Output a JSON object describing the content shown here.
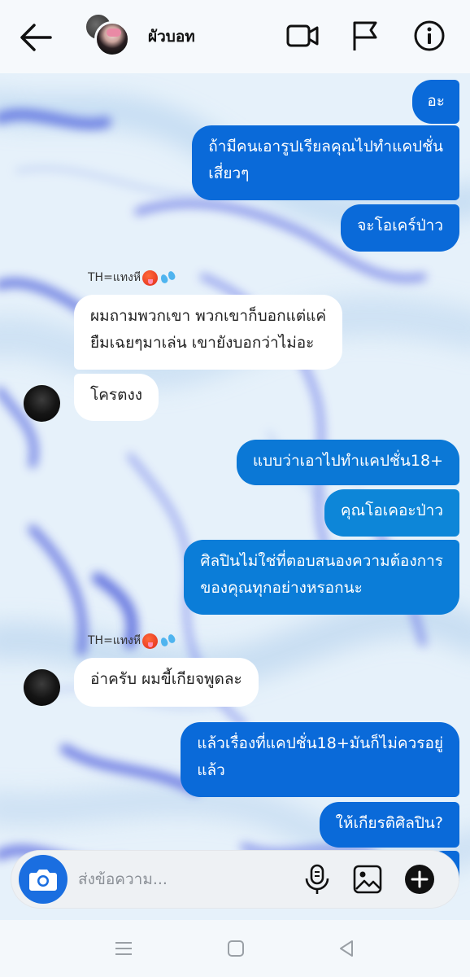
{
  "header": {
    "contact_name": "ผัวบอท",
    "icons": [
      "back-arrow-icon",
      "video-call-icon",
      "flag-icon",
      "info-icon"
    ]
  },
  "messages": [
    {
      "side": "out",
      "text": [
        "อะ"
      ]
    },
    {
      "side": "out",
      "text": [
        "ถ้ามีคนเอารูปเรียลคุณไปทำแคปชั่น",
        "เสี่ยวๆ"
      ]
    },
    {
      "side": "out",
      "text": [
        "จะโอเคร์ป่าว"
      ]
    },
    {
      "side": "in",
      "sender": "TH=แทงหี",
      "text": [
        "ผมถามพวกเขา พวกเขาก็บอกแต่แค่",
        "ยืมเฉยๆมาเล่น เขายังบอกว่าไม่อะ"
      ]
    },
    {
      "side": "in",
      "text": [
        "โครตงง"
      ]
    },
    {
      "side": "out",
      "text": [
        "แบบว่าเอาไปทำแคปชั่น18+"
      ]
    },
    {
      "side": "out",
      "text": [
        "คุณโอเคอะป่าว"
      ]
    },
    {
      "side": "out",
      "text": [
        "ศิลปินไม่ใช่ที่ตอบสนองความต้องการ",
        "ของคุณทุกอย่างหรอกนะ"
      ]
    },
    {
      "side": "in",
      "sender": "TH=แทงหี",
      "text": [
        "อ่าครับ ผมขี้เกียจพูดละ"
      ]
    },
    {
      "side": "out",
      "text": [
        "แล้วเรื่องที่แคปชั่น18+มันก็ไม่ควรอยู่",
        "แล้ว"
      ]
    },
    {
      "side": "out",
      "text": [
        "ให้เกียรติศิลปิน?"
      ]
    }
  ],
  "composer": {
    "placeholder": "ส่งข้อความ...",
    "icons": [
      "camera-icon",
      "microphone-icon",
      "gallery-icon",
      "plus-icon"
    ]
  },
  "colors": {
    "outgoing_bubble": "#0a6ad9",
    "incoming_bubble": "#ffffff",
    "camera_button": "#1a6ee0",
    "chat_background": "#e9f3fb"
  }
}
